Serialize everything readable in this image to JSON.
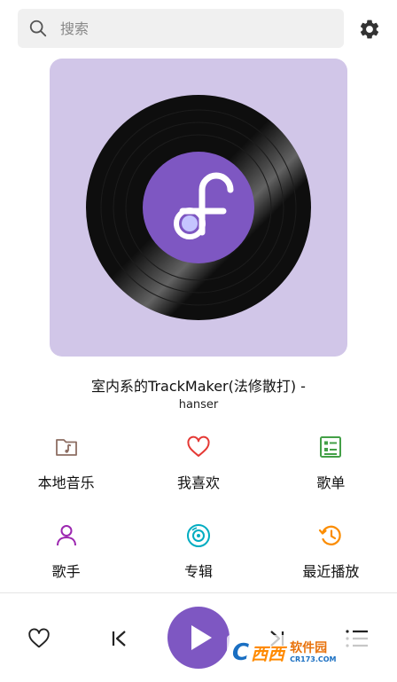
{
  "search": {
    "placeholder": "搜索"
  },
  "now_playing": {
    "title": "室内系的TrackMaker(法修散打) -",
    "artist": "hanser"
  },
  "menu": [
    {
      "label": "本地音乐",
      "icon": "folder-music-icon",
      "color": "#8d6e63"
    },
    {
      "label": "我喜欢",
      "icon": "heart-icon",
      "color": "#e53935"
    },
    {
      "label": "歌单",
      "icon": "playlist-icon",
      "color": "#43a047"
    },
    {
      "label": "歌手",
      "icon": "person-icon",
      "color": "#9c27b0"
    },
    {
      "label": "专辑",
      "icon": "disc-icon",
      "color": "#00acc1"
    },
    {
      "label": "最近播放",
      "icon": "history-icon",
      "color": "#fb8c00"
    }
  ],
  "colors": {
    "accent": "#7e57c2",
    "cover_bg": "#d1c6e8",
    "search_bg": "#f0f0f0"
  },
  "watermark": {
    "glyph": "C",
    "name": "西西",
    "site": "软件园",
    "url": "CR173.COM"
  }
}
